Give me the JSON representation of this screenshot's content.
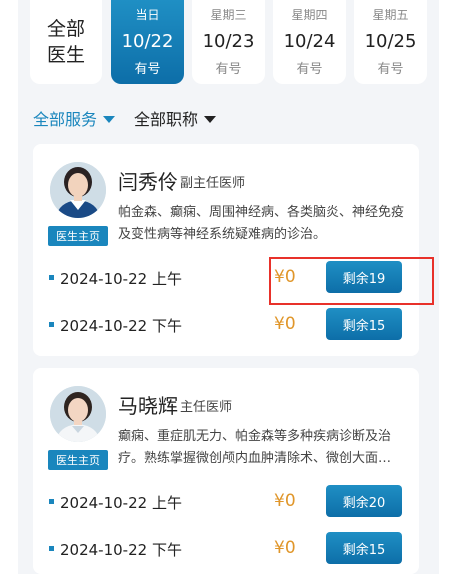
{
  "all_doctors": [
    "全部",
    "医生"
  ],
  "days": [
    {
      "weekday": "当日",
      "date": "10/22",
      "status": "有号",
      "active": true
    },
    {
      "weekday": "星期三",
      "date": "10/23",
      "status": "有号",
      "active": false
    },
    {
      "weekday": "星期四",
      "date": "10/24",
      "status": "有号",
      "active": false
    },
    {
      "weekday": "星期五",
      "date": "10/25",
      "status": "有号",
      "active": false
    }
  ],
  "filters": {
    "services": "全部服务",
    "titles": "全部职称"
  },
  "doctors": [
    {
      "name": "闫秀伶",
      "title": "副主任医师",
      "home_label": "医生主页",
      "desc": "帕金森、癫痫、周围神经病、各类脑炎、神经免疫及变性病等神经系统疑难病的诊治。",
      "slots": [
        {
          "time": "2024-10-22  上午",
          "price": "¥0",
          "remaining": "剩余19"
        },
        {
          "time": "2024-10-22  下午",
          "price": "¥0",
          "remaining": "剩余15"
        }
      ]
    },
    {
      "name": "马晓辉",
      "title": "主任医师",
      "home_label": "医生主页",
      "desc": "癫痫、重症肌无力、帕金森等多种疾病诊断及治疗。熟练掌握微创颅内血肿清除术、微创大面…",
      "slots": [
        {
          "time": "2024-10-22  上午",
          "price": "¥0",
          "remaining": "剩余20"
        },
        {
          "time": "2024-10-22  下午",
          "price": "¥0",
          "remaining": "剩余15"
        }
      ]
    }
  ],
  "colors": {
    "accent": "#1a86bd",
    "price": "#e0962a",
    "highlight": "#e8312a"
  }
}
